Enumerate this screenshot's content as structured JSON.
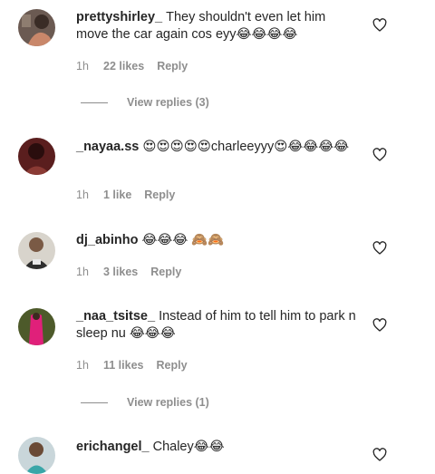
{
  "comments": [
    {
      "username": "prettyshirley_",
      "text": "They shouldn't even let him move the car again cos eyy😂😂😂😂",
      "time": "1h",
      "likes": "22 likes",
      "reply": "Reply",
      "view_replies": "View replies (3)",
      "avatar_icon": "profile-photo"
    },
    {
      "username": "_nayaa.ss",
      "text": "😍😍😍😍😍charleeyyy😍😂😂😂😂",
      "time": "1h",
      "likes": "1 like",
      "reply": "Reply",
      "avatar_icon": "profile-photo"
    },
    {
      "username": "dj_abinho",
      "text": "😂😂😂 🙈🙈",
      "time": "1h",
      "likes": "3 likes",
      "reply": "Reply",
      "avatar_icon": "profile-photo"
    },
    {
      "username": "_naa_tsitse_",
      "text": "Instead of him to tell him to park n sleep nu 😂😂😂",
      "time": "1h",
      "likes": "11 likes",
      "reply": "Reply",
      "view_replies": "View replies (1)",
      "avatar_icon": "profile-photo"
    },
    {
      "username": "erichangel_",
      "text": "Chaley😂😂",
      "avatar_icon": "profile-photo"
    }
  ],
  "icons": {
    "like": "heart-outline-icon"
  },
  "colors": {
    "text": "#262626",
    "secondary": "#8e8e8e",
    "background": "#ffffff"
  }
}
